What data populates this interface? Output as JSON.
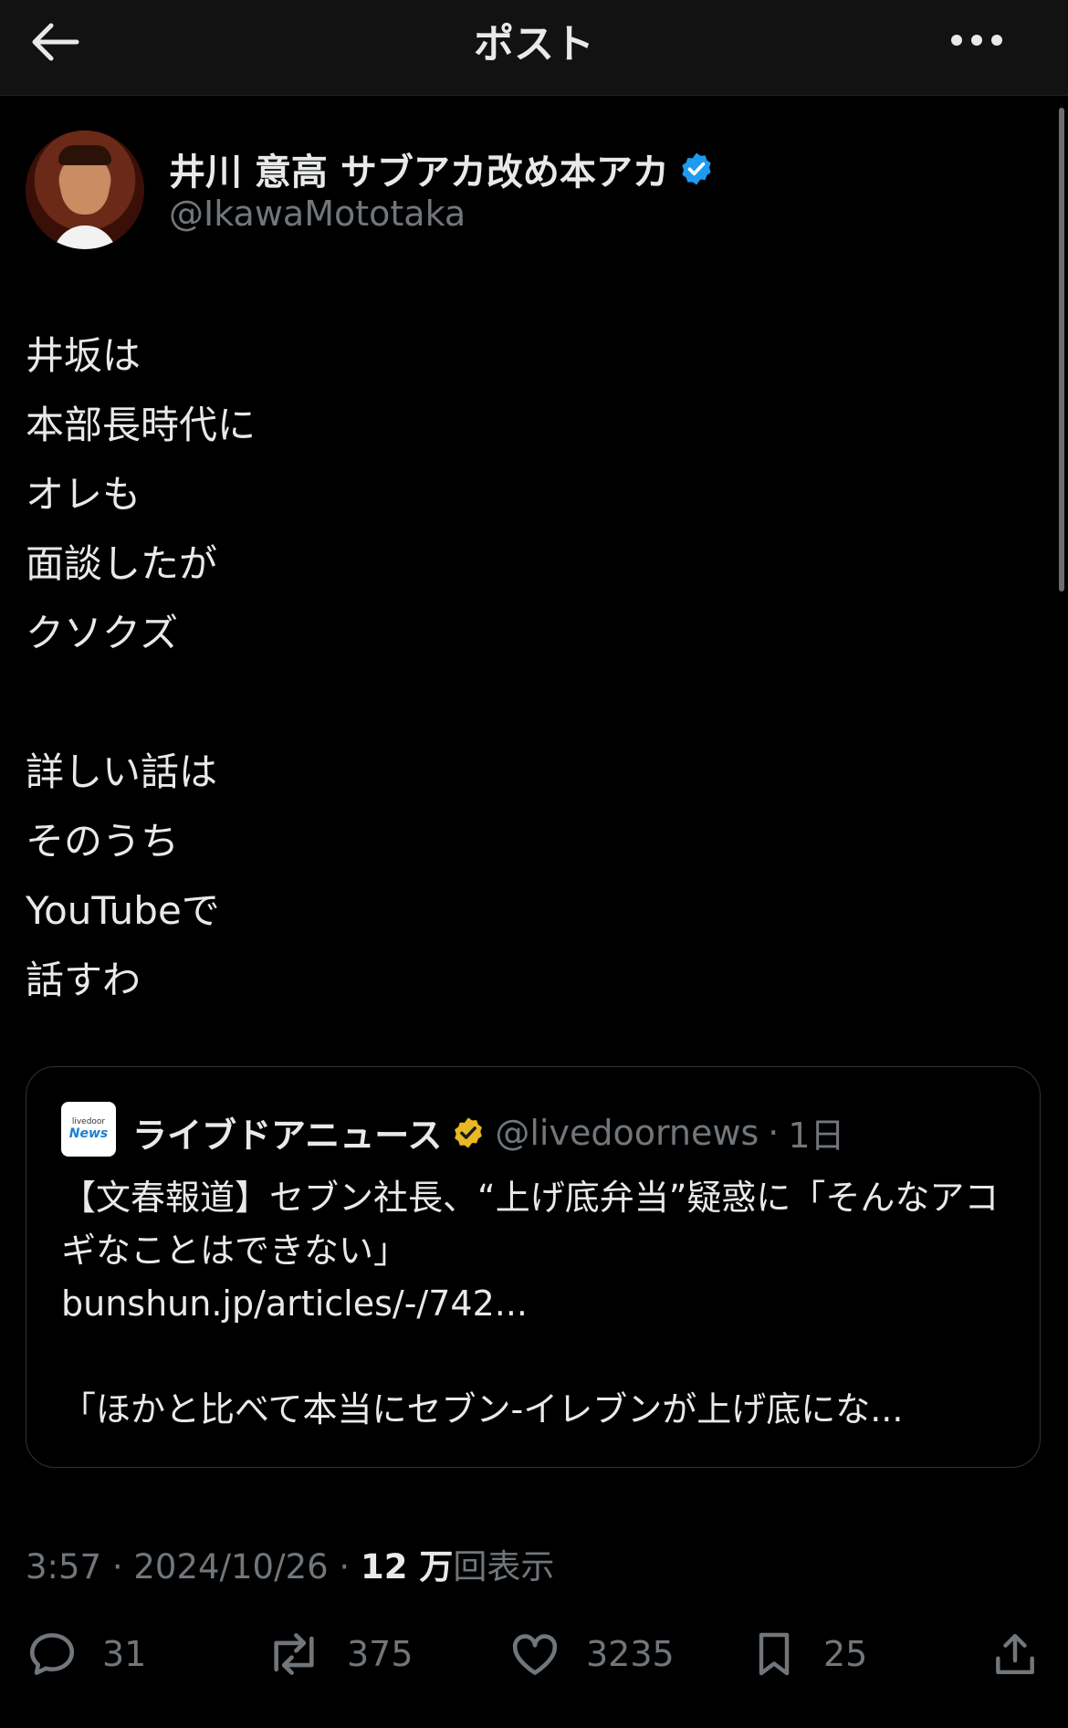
{
  "header": {
    "title": "ポスト"
  },
  "author": {
    "display_name": "井川 意高 サブアカ改め本アカ",
    "handle": "@IkawaMototaka",
    "verified_color": "#1d9bf0"
  },
  "post": {
    "text": "井坂は\n本部長時代に\nオレも\n面談したが\nクソクズ\n\n詳しい話は\nそのうち\nYouTubeで\n話すわ"
  },
  "quote": {
    "logo_top": "livedoor",
    "logo_bottom": "News",
    "name": "ライブドアニュース",
    "handle": "@livedoornews",
    "separator": "·",
    "time": "1日",
    "badge_color": "#e8b923",
    "text": "【文春報道】セブン社長、“上げ底弁当”疑惑に「そんなアコギなことはできない」\nbunshun.jp/articles/-/742...\n\n「ほかと比べて本当にセブン-イレブンが上げ底にな..."
  },
  "meta": {
    "time": "3:57",
    "sep1": " · ",
    "date": "2024/10/26",
    "sep2": " · ",
    "views_count": "12 万",
    "views_label": "回表示"
  },
  "actions": {
    "replies": "31",
    "reposts": "375",
    "likes": "3235",
    "bookmarks": "25"
  }
}
